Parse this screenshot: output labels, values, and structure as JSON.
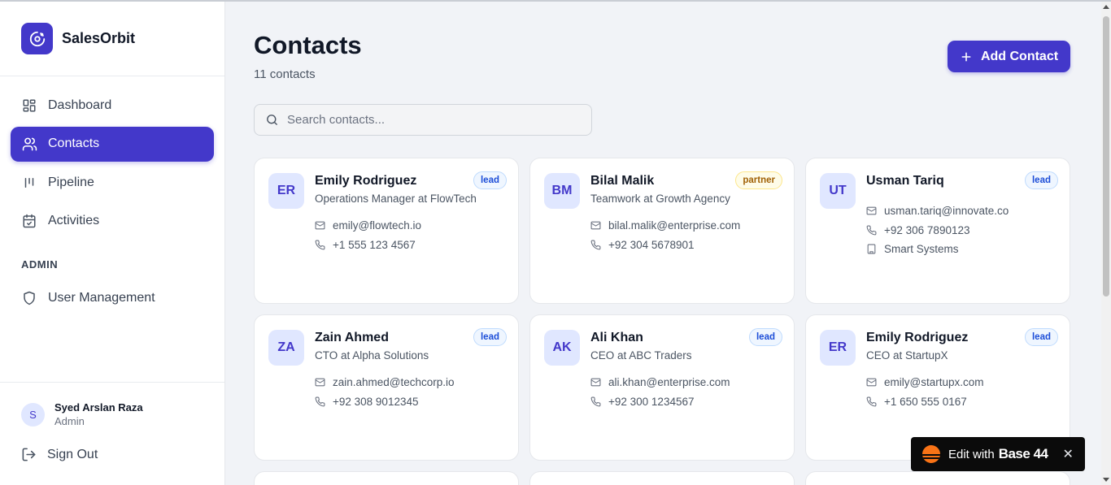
{
  "app": {
    "name": "SalesOrbit",
    "accent": "#4338ca"
  },
  "sidebar": {
    "items": [
      {
        "label": "Dashboard",
        "icon": "dashboard-icon"
      },
      {
        "label": "Contacts",
        "icon": "users-icon",
        "active": true
      },
      {
        "label": "Pipeline",
        "icon": "pipeline-icon"
      },
      {
        "label": "Activities",
        "icon": "calendar-check-icon"
      }
    ],
    "admin_section": "ADMIN",
    "admin_items": [
      {
        "label": "User Management",
        "icon": "shield-icon"
      }
    ],
    "user": {
      "initial": "S",
      "name": "Syed Arslan Raza",
      "role": "Admin"
    },
    "sign_out": "Sign Out"
  },
  "header": {
    "title": "Contacts",
    "count_text": "11 contacts",
    "add_button": "Add Contact"
  },
  "search": {
    "placeholder": "Search contacts...",
    "value": ""
  },
  "contacts": [
    {
      "initials": "ER",
      "name": "Emily Rodriguez",
      "role": "Operations Manager at FlowTech",
      "badge": "lead",
      "email": "emily@flowtech.io",
      "phone": "+1 555 123 4567"
    },
    {
      "initials": "BM",
      "name": "Bilal Malik",
      "role": "Teamwork at Growth Agency",
      "badge": "partner",
      "email": "bilal.malik@enterprise.com",
      "phone": "+92 304 5678901"
    },
    {
      "initials": "UT",
      "name": "Usman Tariq",
      "role": "",
      "badge": "lead",
      "email": "usman.tariq@innovate.co",
      "phone": "+92 306 7890123",
      "company": "Smart Systems"
    },
    {
      "initials": "ZA",
      "name": "Zain Ahmed",
      "role": "CTO at Alpha Solutions",
      "badge": "lead",
      "email": "zain.ahmed@techcorp.io",
      "phone": "+92 308 9012345"
    },
    {
      "initials": "AK",
      "name": "Ali Khan",
      "role": "CEO at ABC Traders",
      "badge": "lead",
      "email": "ali.khan@enterprise.com",
      "phone": "+92 300 1234567"
    },
    {
      "initials": "ER",
      "name": "Emily Rodriguez",
      "role": "CEO at StartupX",
      "badge": "lead",
      "email": "emily@startupx.com",
      "phone": "+1 650 555 0167"
    }
  ],
  "toast": {
    "text": "Edit with",
    "brand": "Base 44"
  }
}
